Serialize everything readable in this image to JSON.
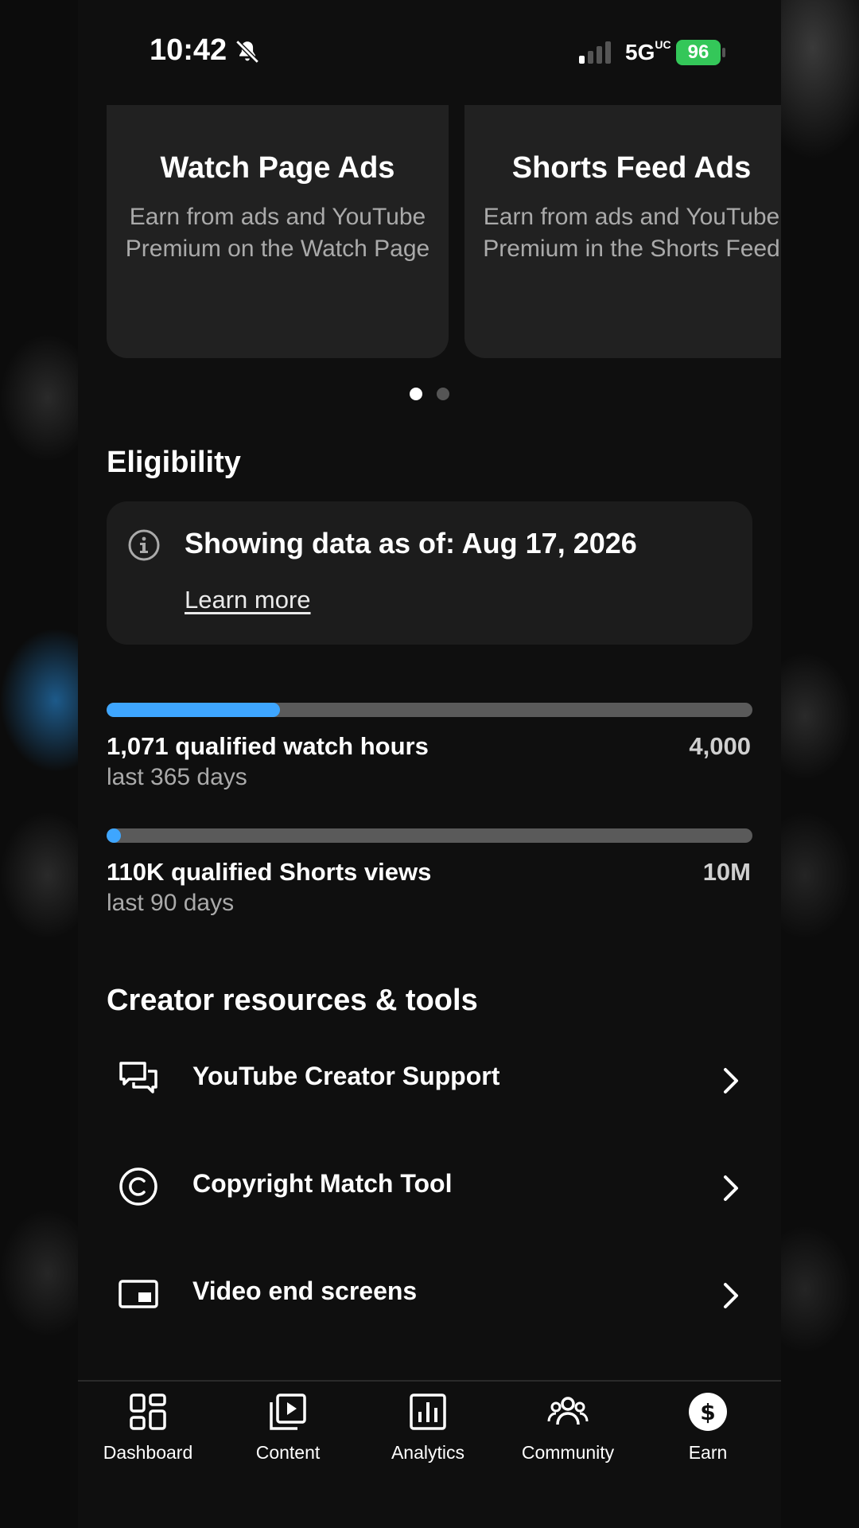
{
  "status_bar": {
    "time": "10:42",
    "network": "5G",
    "network_suffix": "UC",
    "battery": "96"
  },
  "carousel": {
    "cards": [
      {
        "title": "Watch Page Ads",
        "description": "Earn from ads and YouTube Premium on the Watch Page"
      },
      {
        "title": "Shorts Feed Ads",
        "description": "Earn from ads and YouTube Premium in the Shorts Feed"
      }
    ],
    "active_index": 0
  },
  "eligibility": {
    "heading": "Eligibility",
    "info": "Showing data as of: Aug 17, 2026",
    "learn_more": "Learn more",
    "metrics": [
      {
        "label": "1,071 qualified watch hours",
        "period": "last 365 days",
        "goal": "4,000",
        "progress": 0.268
      },
      {
        "label": "110K qualified Shorts views",
        "period": "last 90 days",
        "goal": "10M",
        "progress": 0.011
      }
    ]
  },
  "resources": {
    "heading": "Creator resources & tools",
    "items": [
      {
        "label": "YouTube Creator Support",
        "icon": "chat-bubbles-icon"
      },
      {
        "label": "Copyright Match Tool",
        "icon": "copyright-icon"
      },
      {
        "label": "Video end screens",
        "icon": "end-screen-icon"
      }
    ]
  },
  "nav": {
    "items": [
      {
        "label": "Dashboard",
        "icon": "dashboard-icon"
      },
      {
        "label": "Content",
        "icon": "content-icon"
      },
      {
        "label": "Analytics",
        "icon": "analytics-icon"
      },
      {
        "label": "Community",
        "icon": "community-icon"
      },
      {
        "label": "Earn",
        "icon": "earn-icon"
      }
    ],
    "active": "Earn"
  },
  "colors": {
    "accent": "#3ea6ff",
    "battery": "#34c759",
    "card": "#212121"
  }
}
